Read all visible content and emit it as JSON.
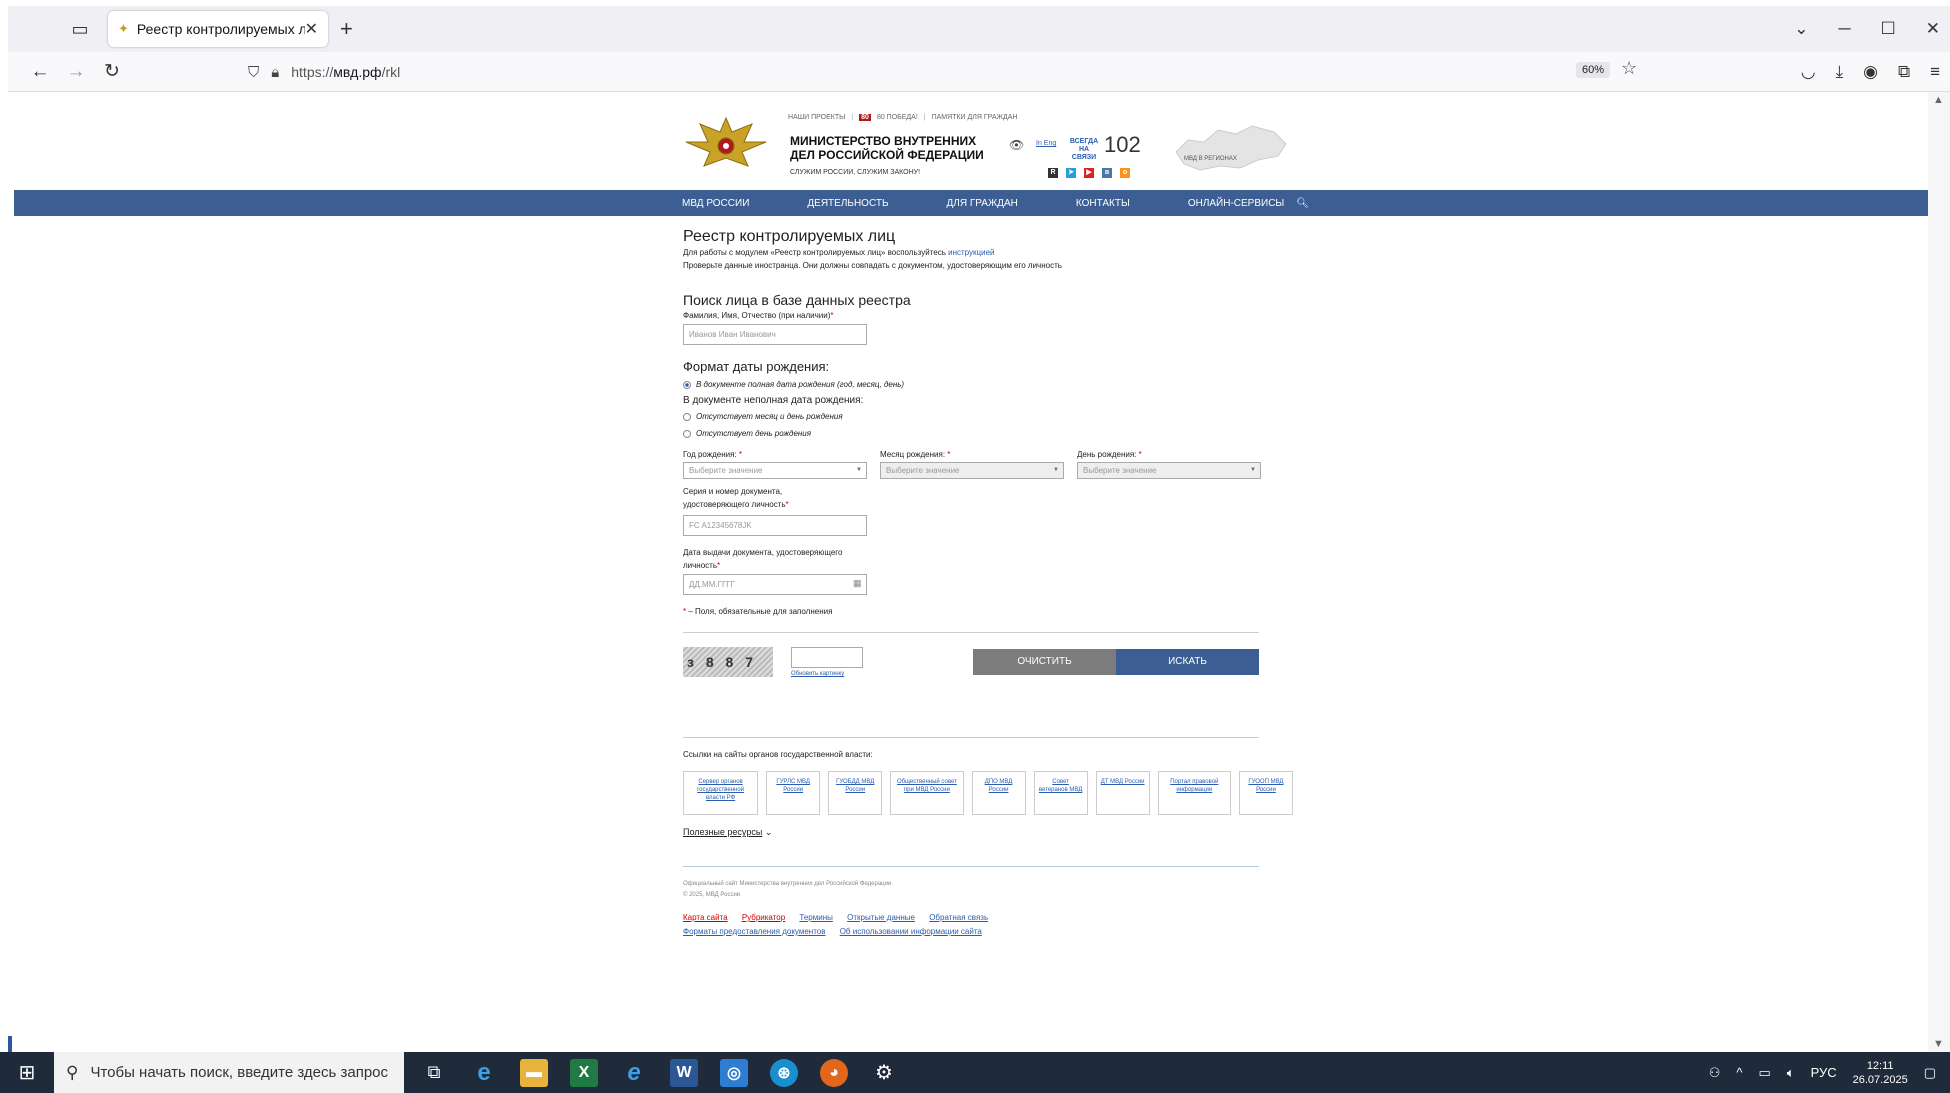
{
  "browser": {
    "tab_title": "Реестр контролируемых лиц",
    "url_prefix": "https://",
    "url_host": "мвд.рф",
    "url_path": "/rkl",
    "zoom": "60%"
  },
  "header": {
    "top_links": [
      "НАШИ ПРОЕКТЫ",
      "80 ПОБЕДА!",
      "ПАМЯТКИ ДЛЯ ГРАЖДАН"
    ],
    "org_name": "МИНИСТЕРСТВО ВНУТРЕННИХ ДЕЛ РОССИЙСКОЙ ФЕДЕРАЦИИ",
    "slogan": "СЛУЖИМ РОССИИ, СЛУЖИМ ЗАКОНУ!",
    "in_eng": "In Eng",
    "always": "ВСЕГДА НА СВЯЗИ",
    "phone": "102",
    "map_label": "МВД В РЕГИОНАХ"
  },
  "menu": [
    "МВД РОССИИ",
    "ДЕЯТЕЛЬНОСТЬ",
    "ДЛЯ ГРАЖДАН",
    "КОНТАКТЫ",
    "ОНЛАЙН-СЕРВИСЫ"
  ],
  "form": {
    "title": "Реестр контролируемых лиц",
    "note1_before": "Для работы с модулем «Реестр контролируемых лиц» воспользуйтесь ",
    "note1_link": "инструкцией",
    "note2": "Проверьте данные иностранца. Они должны совпадать с документом, удостоверяющим его личность",
    "search_title": "Поиск лица в базе данных реестра",
    "fio_label": "Фамилия, Имя, Отчество (при наличии)",
    "fio_placeholder": "Иванов Иван Иванович",
    "dob_format_title": "Формат даты рождения:",
    "radio_full": "В документе полная дата рождения (год, месяц, день)",
    "partial_title": "В документе неполная дата рождения:",
    "radio_no_month_day": "Отсутствует месяц и день рождения",
    "radio_no_day": "Отсутствует день рождения",
    "year_label": "Год рождения:",
    "month_label": "Месяц рождения:",
    "day_label": "День рождения:",
    "select_placeholder": "Выберите значение",
    "doc_label_1": "Серия и номер документа,",
    "doc_label_2": "удостоверяющего личность",
    "doc_placeholder": "FC A12345678JK",
    "issue_label_1": "Дата выдачи документа, удостоверяющего",
    "issue_label_2": "личность",
    "issue_placeholder": "ДД.ММ.ГГГГ",
    "required_note": "– Поля, обязательные для заполнения",
    "captcha_text": "з 8 8 7",
    "refresh_captcha": "Обновить картинку",
    "clear_button": "ОЧИСТИТЬ",
    "search_button": "ИСКАТЬ"
  },
  "footer": {
    "links_title": "Ссылки на сайты органов государственной власти:",
    "gov_links": [
      "Сервер органов государственной власти РФ",
      "ГУРЛС МВД России",
      "ГУОБДД МВД России",
      "Общественный совет при МВД России",
      "ДПО МВД России",
      "Совет ветеранов МВД",
      "ДТ МВД России",
      "Портал правовой информации",
      "ГУООП МВД России"
    ],
    "useful": "Полезные ресурсы",
    "copy1": "Официальный сайт Министерства внутренних дел Российской Федерации",
    "copy2": "© 2025, МВД России",
    "link_sitemap": "Карта сайта",
    "link_rubricator": "Рубрикатор",
    "link_terms": "Термины",
    "link_open_data": "Открытые данные",
    "link_feedback": "Обратная связь",
    "link_formats": "Форматы предоставления документов",
    "link_usage": "Об использовании информации сайта"
  },
  "taskbar": {
    "search_placeholder": "Чтобы начать поиск, введите здесь запрос",
    "lang": "РУС",
    "time": "12:11",
    "date": "26.07.2025"
  }
}
